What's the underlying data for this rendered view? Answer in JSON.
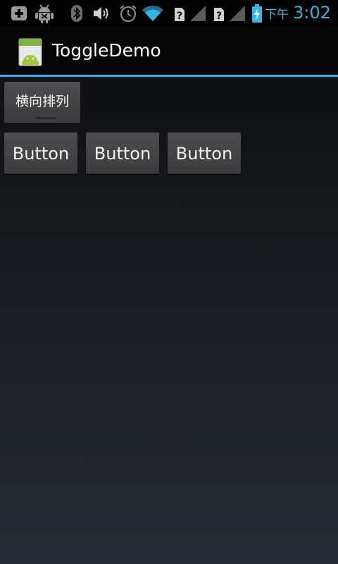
{
  "status_bar": {
    "icons": [
      "add-notification-icon",
      "android-debug-icon",
      "bluetooth-icon",
      "volume-icon",
      "alarm-icon",
      "wifi-icon",
      "sim-unknown-1-icon",
      "signal-1-icon",
      "sim-unknown-2-icon",
      "signal-2-icon",
      "battery-charging-icon"
    ],
    "time_period": "下午",
    "time": "3:02"
  },
  "action_bar": {
    "title": "ToggleDemo",
    "accent_color": "#33b5e5"
  },
  "content": {
    "toggle_button": {
      "label": "横向排列",
      "checked": false
    },
    "buttons": [
      {
        "label": "Button"
      },
      {
        "label": "Button"
      },
      {
        "label": "Button"
      }
    ]
  }
}
